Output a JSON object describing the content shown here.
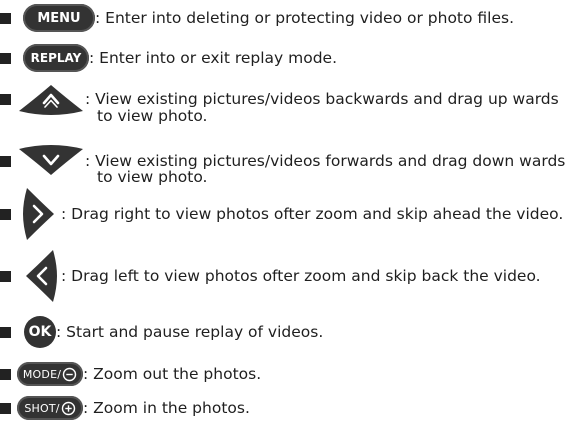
{
  "rows": [
    {
      "button_label": "MENU",
      "text": ": Enter into deleting or protecting video or photo files."
    },
    {
      "button_label": "REPLAY",
      "text": ": Enter into or exit replay mode."
    },
    {
      "icon": "up-chevron-icon",
      "text": ": View existing pictures/videos backwards and drag up wards",
      "text2": "to view photo."
    },
    {
      "icon": "down-chevron-icon",
      "text": ": View existing pictures/videos forwards and drag down wards",
      "text2": "to view photo."
    },
    {
      "icon": "right-chevron-icon",
      "text": ": Drag right to view photos ofter zoom and skip ahead the video."
    },
    {
      "icon": "left-chevron-icon",
      "text": ": Drag left to view photos ofter zoom and skip back the video."
    },
    {
      "button_label": "OK",
      "text": ": Start and pause replay of videos."
    },
    {
      "button_label": "MODE/",
      "icon": "minus-circle-icon",
      "text": ": Zoom out the photos."
    },
    {
      "button_label": "SHOT/",
      "icon": "plus-circle-icon",
      "text": ": Zoom in the photos."
    }
  ]
}
